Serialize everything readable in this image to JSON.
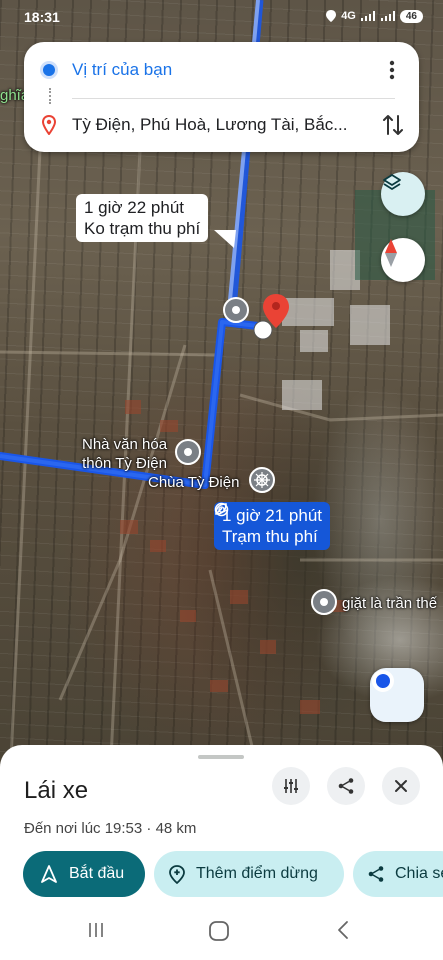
{
  "status_bar": {
    "time": "18:31",
    "signal": "4G",
    "battery": "46"
  },
  "search": {
    "origin": "Vị trí của bạn",
    "destination": "Tỳ Điện, Phú Hoà, Lương Tài, Bắc..."
  },
  "map": {
    "left_edge_label": "ghĩa",
    "alt_route": {
      "duration": "1 giờ 22 phút",
      "note": "Ko trạm thu phí"
    },
    "main_route": {
      "duration": "1 giờ 21 phút",
      "note": "Trạm thu phí"
    },
    "places": {
      "culture_house_line1": "Nhà văn hóa",
      "culture_house_line2": "thôn Tỳ Điện",
      "pagoda": "Chùa Tỳ Điện",
      "laundry": "giặt là trần thế"
    }
  },
  "sheet": {
    "mode_title": "Lái xe",
    "arrival": "Đến nơi lúc 19:53 · 48 km",
    "start_label": "Bắt đầu",
    "add_stop_label": "Thêm điểm dừng",
    "share_label": "Chia sẻ"
  },
  "colors": {
    "route_primary": "#1a56e8",
    "route_alt": "#7ea1f0",
    "accent": "#0b6b78",
    "chip": "#c9eef1",
    "pin": "#ea4335"
  }
}
